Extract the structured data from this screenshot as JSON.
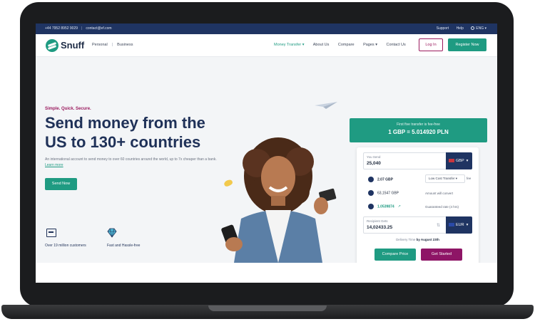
{
  "topbar": {
    "phone": "+44 7952 8952 9029",
    "email": "contact@ef.com",
    "support": "Support",
    "help": "Help",
    "language": "ENG"
  },
  "nav": {
    "logo": "Snuff",
    "personal": "Personal",
    "business": "Business",
    "links": [
      "Money Transfer",
      "About Us",
      "Compare",
      "Pages",
      "Contact Us"
    ],
    "login": "Log In",
    "register": "Register Now"
  },
  "hero": {
    "tagline": "Simple. Quick. Secure.",
    "headline": "Send money from the US to 130+ countries",
    "subtext": "An international account to send money to over 60 countries around the world, up to 7x cheaper than a bank.",
    "learn_more": "Learn more",
    "send_button": "Send Now",
    "features": [
      "Over 19 million customers",
      "Fast and Hassle-free"
    ]
  },
  "rate": {
    "subtitle": "First five transfer is fee-free",
    "main": "1 GBP = 5.014920 PLN"
  },
  "converter": {
    "send_label": "You Send",
    "send_value": "25,040",
    "send_currency": "GBP",
    "fee_value": "2.07 GBP",
    "transfer_type": "Low Cost Transfer",
    "fee_label": "fee",
    "convert_amount": "63,1547 GBP",
    "convert_label": "Amount will convert",
    "rate_value": "1.0539874",
    "rate_label": "Guaranteed rate (4 hrs)",
    "recv_label": "Recipient Gets",
    "recv_value": "14,02433.25",
    "recv_currency": "EUR",
    "delivery_prefix": "Delivery Time",
    "delivery_date": "by August 23th",
    "compare_button": "Compare Price",
    "start_button": "Get Started"
  },
  "colors": {
    "brand_green": "#1f9b82",
    "navy": "#1f3158",
    "magenta": "#9b1a5e"
  }
}
